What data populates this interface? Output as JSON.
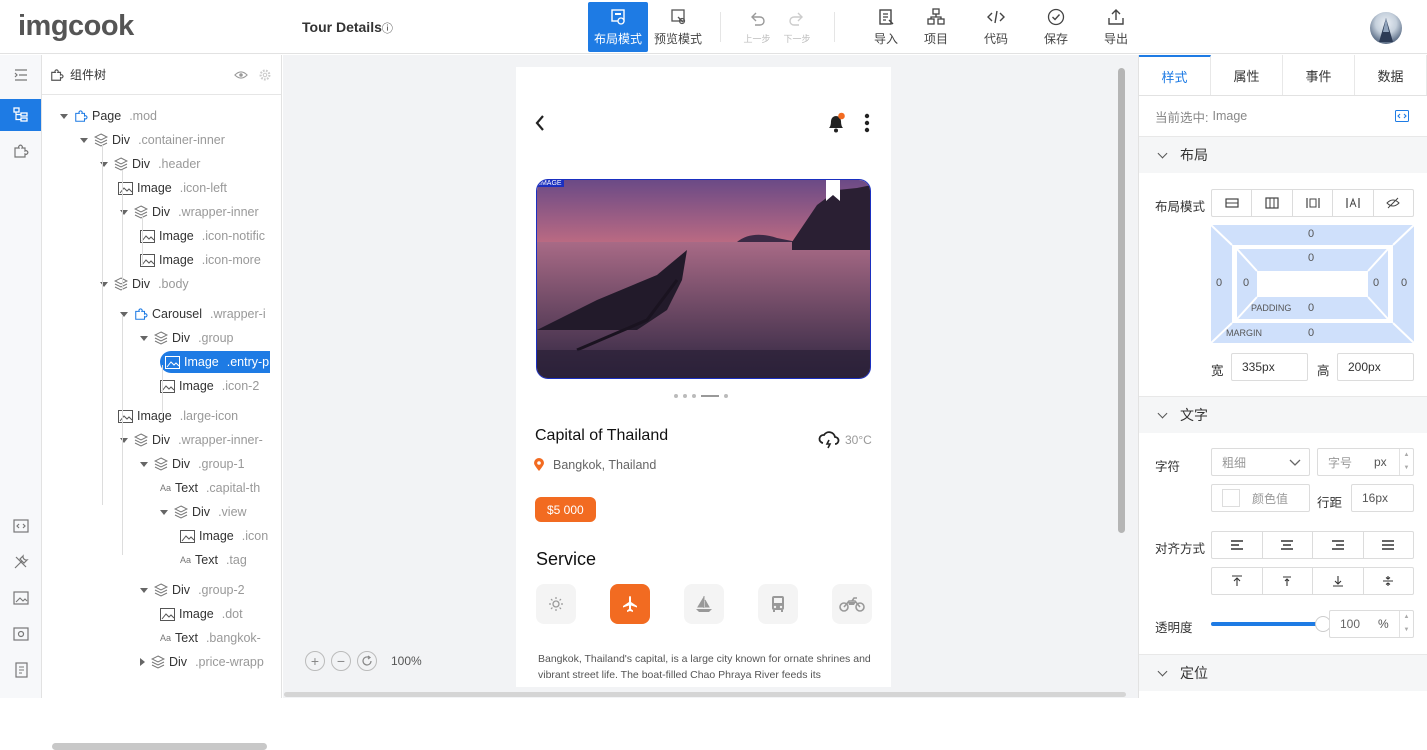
{
  "app": {
    "logo": "imgcook",
    "page_title": "Tour Details",
    "info_glyph": "ⓘ"
  },
  "toolbar": {
    "layout_mode": "布局模式",
    "preview_mode": "预览模式",
    "undo": "上一步",
    "redo": "下一步",
    "import": "导入",
    "project": "项目",
    "code": "代码",
    "save": "保存",
    "export": "导出"
  },
  "tree": {
    "title": "组件树",
    "rows": [
      {
        "name": "Page",
        "cls": ".mod",
        "icon": "component-icon",
        "caret": "down"
      },
      {
        "name": "Div",
        "cls": ".container-inner",
        "icon": "layers-icon",
        "caret": "down"
      },
      {
        "name": "Div",
        "cls": ".header",
        "icon": "layers-icon",
        "caret": "down"
      },
      {
        "name": "Image",
        "cls": ".icon-left",
        "icon": "image-icon",
        "caret": ""
      },
      {
        "name": "Div",
        "cls": ".wrapper-inner",
        "icon": "layers-icon",
        "caret": "down"
      },
      {
        "name": "Image",
        "cls": ".icon-notific",
        "icon": "image-icon",
        "caret": ""
      },
      {
        "name": "Image",
        "cls": ".icon-more",
        "icon": "image-icon",
        "caret": ""
      },
      {
        "name": "Div",
        "cls": ".body",
        "icon": "layers-icon",
        "caret": "down"
      },
      {
        "name": "Carousel",
        "cls": ".wrapper-i",
        "icon": "component-icon",
        "caret": "down"
      },
      {
        "name": "Div",
        "cls": ".group",
        "icon": "layers-icon",
        "caret": "down"
      },
      {
        "name": "Image",
        "cls": ".entry-p",
        "icon": "image-icon",
        "caret": ""
      },
      {
        "name": "Image",
        "cls": ".icon-2",
        "icon": "image-icon",
        "caret": ""
      },
      {
        "name": "Image",
        "cls": ".large-icon",
        "icon": "image-icon",
        "caret": ""
      },
      {
        "name": "Div",
        "cls": ".wrapper-inner-",
        "icon": "layers-icon",
        "caret": "down"
      },
      {
        "name": "Div",
        "cls": ".group-1",
        "icon": "layers-icon",
        "caret": "down"
      },
      {
        "name": "Text",
        "cls": ".capital-th",
        "icon": "text-icon",
        "caret": ""
      },
      {
        "name": "Div",
        "cls": ".view",
        "icon": "layers-icon",
        "caret": "down"
      },
      {
        "name": "Image",
        "cls": ".icon",
        "icon": "image-icon",
        "caret": ""
      },
      {
        "name": "Text",
        "cls": ".tag",
        "icon": "text-icon",
        "caret": ""
      },
      {
        "name": "Div",
        "cls": ".group-2",
        "icon": "layers-icon",
        "caret": "down"
      },
      {
        "name": "Image",
        "cls": ".dot",
        "icon": "image-icon",
        "caret": ""
      },
      {
        "name": "Text",
        "cls": ".bangkok-",
        "icon": "text-icon",
        "caret": ""
      },
      {
        "name": "Div",
        "cls": ".price-wrapp",
        "icon": "layers-icon",
        "caret": "right"
      }
    ]
  },
  "phone": {
    "image_badge": "IMAGE",
    "tour_title": "Capital of Thailand",
    "temperature": "30°C",
    "location": "Bangkok, Thailand",
    "price": "$5 000",
    "service_heading": "Service",
    "description": "Bangkok, Thailand's capital, is a large city known for ornate shrines and vibrant street life. The boat-filled Chao Phraya River feeds its"
  },
  "zoom": {
    "level": "100%"
  },
  "panel": {
    "tabs": [
      "样式",
      "属性",
      "事件",
      "数据"
    ],
    "selected_label": "当前选中:",
    "selected_value": "Image",
    "layout_section": "布局",
    "layout_mode_label": "布局模式",
    "margin_label": "MARGIN",
    "padding_label": "PADDING",
    "box_values": {
      "margin_top": "0",
      "margin_left": "0",
      "margin_right": "0",
      "margin_bottom": "0",
      "padding_top": "0",
      "padding_left": "0",
      "padding_right": "0",
      "padding_bottom": "0"
    },
    "width_label": "宽",
    "width_value": "335px",
    "height_label": "高",
    "height_value": "200px",
    "text_section": "文字",
    "font_label": "字符",
    "weight_placeholder": "粗细",
    "size_placeholder": "字号",
    "size_unit": "px",
    "color_placeholder": "颜色值",
    "line_height_label": "行距",
    "line_height_value": "16px",
    "align_label": "对齐方式",
    "opacity_label": "透明度",
    "opacity_value": "100",
    "opacity_unit": "%",
    "opacity_level": 1.0,
    "position_section": "定位"
  },
  "colors": {
    "accent": "#1e7be4",
    "orange": "#f26b21"
  }
}
